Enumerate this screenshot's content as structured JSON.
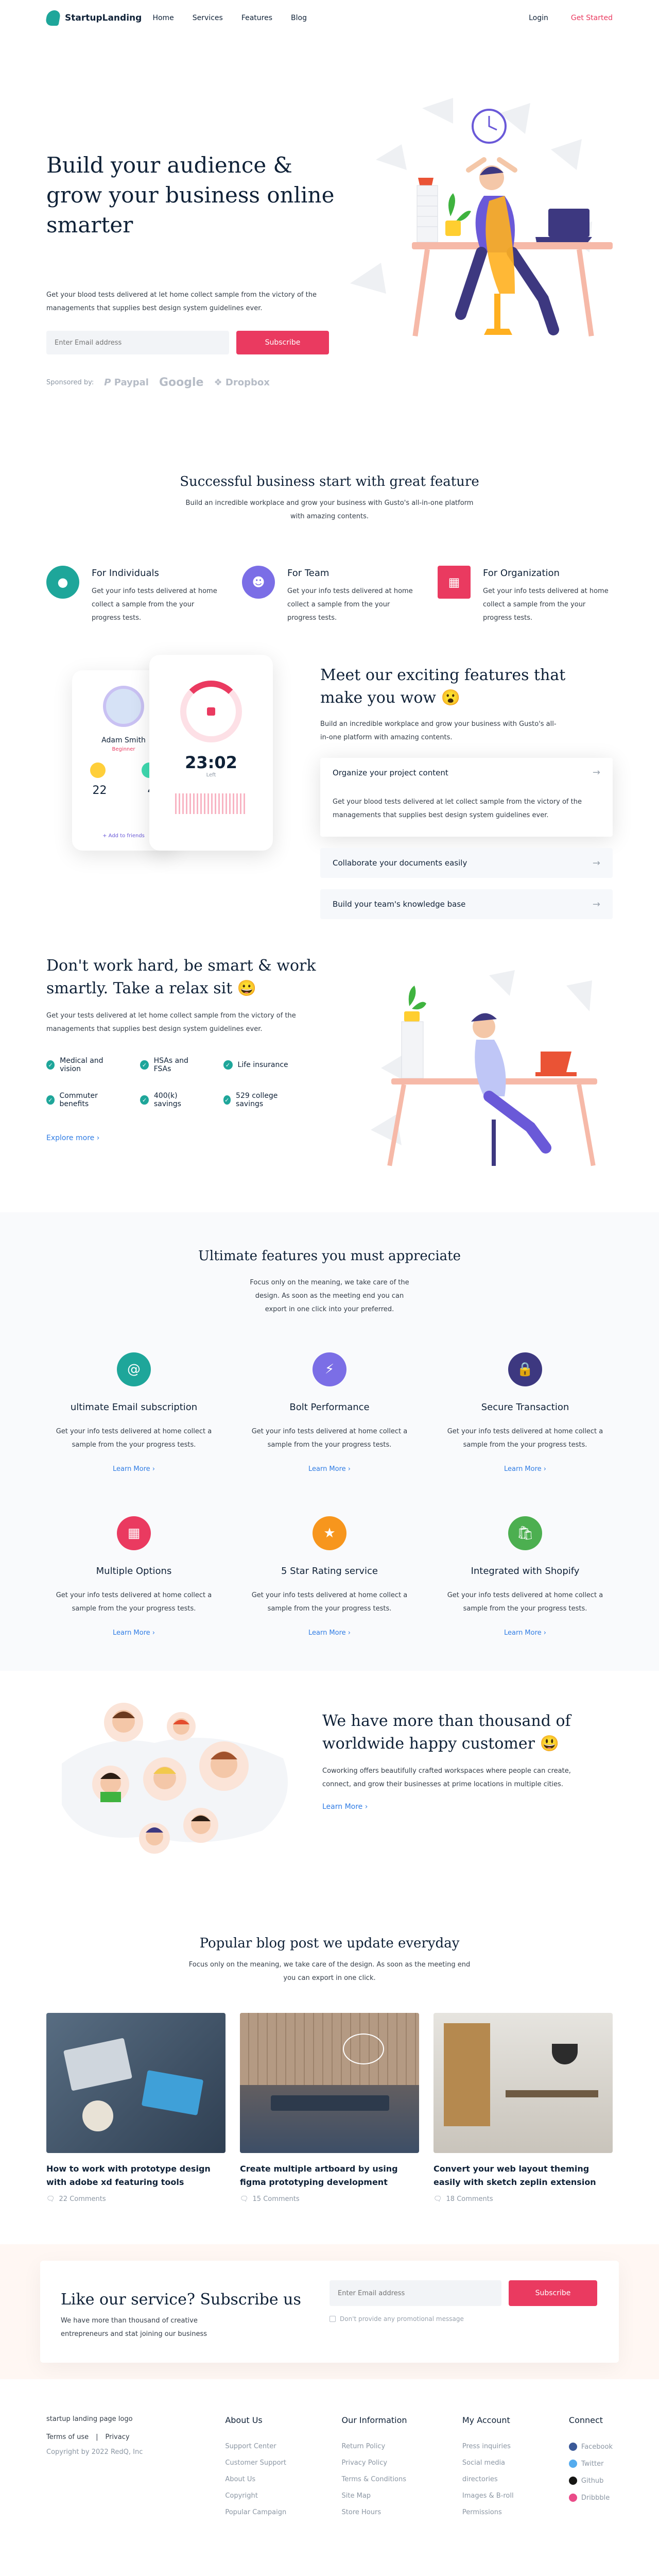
{
  "header": {
    "brand": "StartupLanding",
    "nav": [
      "Home",
      "Services",
      "Features",
      "Blog"
    ],
    "login": "Login",
    "get_started": "Get Started"
  },
  "hero": {
    "title": "Build your audience & grow your business online smarter",
    "description": "Get your blood tests delivered at let home collect sample from the victory of the managements that supplies best design system guidelines ever.",
    "email_placeholder": "Enter Email address",
    "subscribe": "Subscribe",
    "sponsored_by": "Sponsored by:",
    "sponsors": [
      "Paypal",
      "Google",
      "Dropbox"
    ]
  },
  "great_feature": {
    "title": "Successful business start with great feature",
    "description": "Build an incredible workplace and grow your business with Gusto's all-in-one platform with amazing contents.",
    "items": [
      {
        "title": "For Individuals",
        "text": "Get your info tests delivered at home collect a sample from the your progress tests.",
        "color": "#1ea69a"
      },
      {
        "title": "For Team",
        "text": "Get your info tests delivered at home collect a sample from the your progress tests.",
        "color": "#7b6ee6"
      },
      {
        "title": "For Organization",
        "text": "Get your info tests delivered at home collect a sample from the your progress tests.",
        "color": "#ea3a60"
      }
    ]
  },
  "exciting": {
    "title": "Meet our exciting features that make you wow 😮",
    "description": "Build an incredible workplace and grow your business with Gusto's all-in-one platform with amazing contents.",
    "profile_name": "Adam Smith",
    "profile_role": "Beginner",
    "stat1": "22",
    "stat2": "4",
    "add_friends": "+ Add to friends",
    "timer": "23:02",
    "timer_label": "Left",
    "accordion": [
      {
        "title": "Organize your project content",
        "body": "Get your blood tests delivered at let collect sample from the victory of the managements that supplies best design system guidelines ever."
      },
      {
        "title": "Collaborate your documents easily"
      },
      {
        "title": "Build your team's knowledge base"
      }
    ]
  },
  "work_smart": {
    "title": "Don't work hard, be smart & work smartly. Take a relax sit 😀",
    "description": "Get your tests delivered at let home collect sample from the victory of the managements that supplies best design system guidelines ever.",
    "checks": [
      "Medical and vision",
      "HSAs and FSAs",
      "Life insurance",
      "Commuter benefits",
      "400(k) savings",
      "529 college savings"
    ],
    "explore": "Explore more"
  },
  "ultimate": {
    "title": "Ultimate features you must appreciate",
    "description": "Focus only on the meaning, we take care of the design. As soon as the meeting end you can export in one click into your preferred.",
    "learn_more": "Learn More",
    "cards": [
      {
        "title": "ultimate Email subscription",
        "text": "Get your info tests delivered at home collect a sample from the your progress tests.",
        "color": "#1ea69a",
        "icon": "at-icon"
      },
      {
        "title": "Bolt Performance",
        "text": "Get your info tests delivered at home collect a sample from the your progress tests.",
        "color": "#7b6ee6",
        "icon": "bolt-icon"
      },
      {
        "title": "Secure Transaction",
        "text": "Get your info tests delivered at home collect a sample from the your progress tests.",
        "color": "#3d3880",
        "icon": "lock-icon"
      },
      {
        "title": "Multiple Options",
        "text": "Get your info tests delivered at home collect a sample from the your progress tests.",
        "color": "#ea3a60",
        "icon": "grid-icon"
      },
      {
        "title": "5 Star Rating service",
        "text": "Get your info tests delivered at home collect a sample from the your progress tests.",
        "color": "#f7961d",
        "icon": "star-icon"
      },
      {
        "title": "Integrated with Shopify",
        "text": "Get your info tests delivered at home collect a sample from the your progress tests.",
        "color": "#4caf50",
        "icon": "bag-icon"
      }
    ]
  },
  "customers": {
    "title": "We have more than thousand of worldwide happy customer 😃",
    "description": "Coworking offers beautifully crafted workspaces where people can create, connect, and grow their businesses at prime locations in multiple cities.",
    "learn_more": "Learn More"
  },
  "blog": {
    "title": "Popular blog post we update everyday",
    "description": "Focus only on the meaning, we take care of the design. As soon as the meeting end you can export in one click.",
    "posts": [
      {
        "title": "How to work with prototype design with adobe xd featuring tools",
        "comments": "22 Comments"
      },
      {
        "title": "Create multiple artboard by using figma prototyping development",
        "comments": "15 Comments"
      },
      {
        "title": "Convert your web layout theming easily with sketch zeplin extension",
        "comments": "18 Comments"
      }
    ]
  },
  "subscribe": {
    "title": "Like our service? Subscribe us",
    "description": "We have more than thousand of creative entrepreneurs and stat joining our business",
    "placeholder": "Enter Email address",
    "button": "Subscribe",
    "checkbox": "Don't provide any promotional message"
  },
  "footer": {
    "logo_alt": "startup landing page logo",
    "terms": "Terms of use",
    "privacy": "Privacy",
    "copyright": "Copyright by 2022 RedQ, Inc",
    "cols": [
      {
        "title": "About Us",
        "items": [
          "Support Center",
          "Customer Support",
          "About Us",
          "Copyright",
          "Popular Campaign"
        ]
      },
      {
        "title": "Our Information",
        "items": [
          "Return Policy",
          "Privacy Policy",
          "Terms & Conditions",
          "Site Map",
          "Store Hours"
        ]
      },
      {
        "title": "My Account",
        "items": [
          "Press inquiries",
          "Social media",
          "directories",
          "Images & B-roll",
          "Permissions"
        ]
      },
      {
        "title": "Connect",
        "items": [
          "Facebook",
          "Twitter",
          "Github",
          "Dribbble"
        ]
      }
    ]
  }
}
